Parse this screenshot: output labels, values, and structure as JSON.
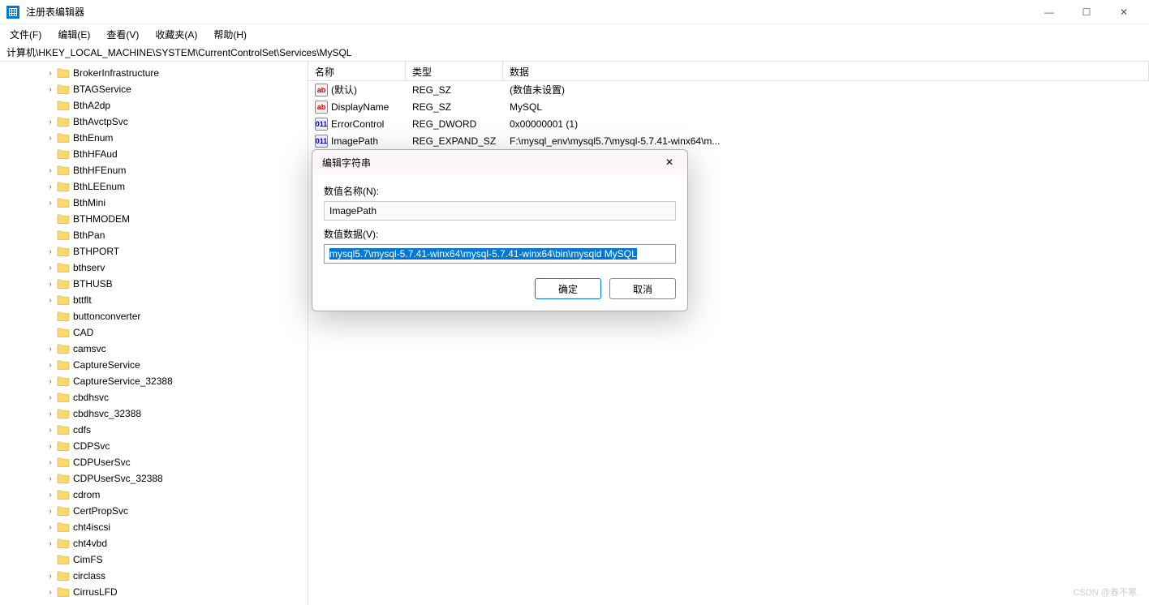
{
  "window": {
    "title": "注册表编辑器",
    "controls": {
      "min": "—",
      "max": "☐",
      "close": "✕"
    }
  },
  "menubar": {
    "file": "文件(F)",
    "edit": "编辑(E)",
    "view": "查看(V)",
    "favorites": "收藏夹(A)",
    "help": "帮助(H)"
  },
  "path": "计算机\\HKEY_LOCAL_MACHINE\\SYSTEM\\CurrentControlSet\\Services\\MySQL",
  "tree": [
    {
      "label": "BrokerInfrastructure",
      "expandable": true
    },
    {
      "label": "BTAGService",
      "expandable": true
    },
    {
      "label": "BthA2dp",
      "expandable": false
    },
    {
      "label": "BthAvctpSvc",
      "expandable": true
    },
    {
      "label": "BthEnum",
      "expandable": true
    },
    {
      "label": "BthHFAud",
      "expandable": false
    },
    {
      "label": "BthHFEnum",
      "expandable": true
    },
    {
      "label": "BthLEEnum",
      "expandable": true
    },
    {
      "label": "BthMini",
      "expandable": true
    },
    {
      "label": "BTHMODEM",
      "expandable": false
    },
    {
      "label": "BthPan",
      "expandable": false
    },
    {
      "label": "BTHPORT",
      "expandable": true
    },
    {
      "label": "bthserv",
      "expandable": true
    },
    {
      "label": "BTHUSB",
      "expandable": true
    },
    {
      "label": "bttflt",
      "expandable": true
    },
    {
      "label": "buttonconverter",
      "expandable": false
    },
    {
      "label": "CAD",
      "expandable": false
    },
    {
      "label": "camsvc",
      "expandable": true
    },
    {
      "label": "CaptureService",
      "expandable": true
    },
    {
      "label": "CaptureService_32388",
      "expandable": true
    },
    {
      "label": "cbdhsvc",
      "expandable": true
    },
    {
      "label": "cbdhsvc_32388",
      "expandable": true
    },
    {
      "label": "cdfs",
      "expandable": true
    },
    {
      "label": "CDPSvc",
      "expandable": true
    },
    {
      "label": "CDPUserSvc",
      "expandable": true
    },
    {
      "label": "CDPUserSvc_32388",
      "expandable": true
    },
    {
      "label": "cdrom",
      "expandable": true
    },
    {
      "label": "CertPropSvc",
      "expandable": true
    },
    {
      "label": "cht4iscsi",
      "expandable": true
    },
    {
      "label": "cht4vbd",
      "expandable": true
    },
    {
      "label": "CimFS",
      "expandable": false
    },
    {
      "label": "circlass",
      "expandable": true
    },
    {
      "label": "CirrusLFD",
      "expandable": true
    }
  ],
  "list": {
    "headers": {
      "name": "名称",
      "type": "类型",
      "data": "数据"
    },
    "rows": [
      {
        "name": "(默认)",
        "type": "REG_SZ",
        "data": "(数值未设置)",
        "icon": "sz"
      },
      {
        "name": "DisplayName",
        "type": "REG_SZ",
        "data": "MySQL",
        "icon": "sz"
      },
      {
        "name": "ErrorControl",
        "type": "REG_DWORD",
        "data": "0x00000001 (1)",
        "icon": "bin"
      },
      {
        "name": "ImagePath",
        "type": "REG_EXPAND_SZ",
        "data": "F:\\mysql_env\\mysql5.7\\mysql-5.7.41-winx64\\m...",
        "icon": "bin"
      }
    ]
  },
  "dialog": {
    "title": "编辑字符串",
    "close": "✕",
    "name_label": "数值名称(N):",
    "name_value": "ImagePath",
    "data_label": "数值数据(V):",
    "data_value": "mysql5.7\\mysql-5.7.41-winx64\\mysql-5.7.41-winx64\\bin\\mysqld MySQL",
    "ok": "确定",
    "cancel": "取消"
  },
  "watermark": "CSDN @春不寒."
}
